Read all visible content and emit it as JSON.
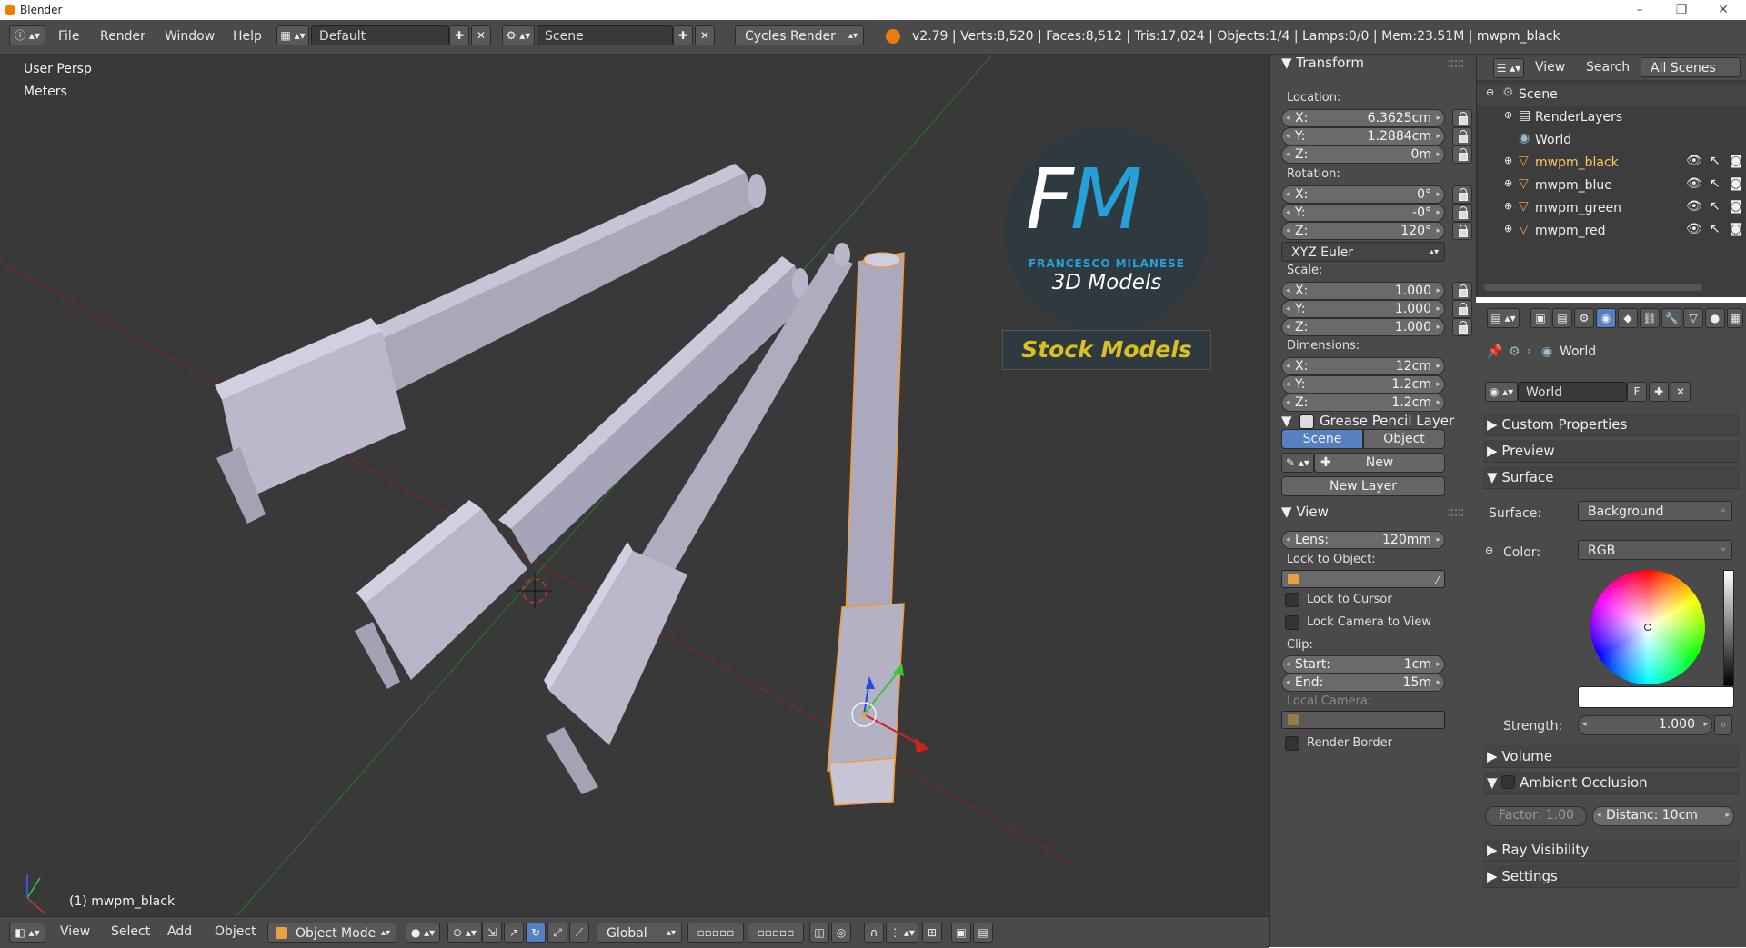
{
  "window": {
    "title": "Blender"
  },
  "topbar": {
    "menus": [
      "File",
      "Render",
      "Window",
      "Help"
    ],
    "screen_layout": "Default",
    "scene": "Scene",
    "engine": "Cycles Render",
    "stats": "v2.79 | Verts:8,520 | Faces:8,512 | Tris:17,024 | Objects:1/4 | Lamps:0/0 | Mem:23.51M | mwpm_black"
  },
  "viewport": {
    "view_name": "User Persp",
    "units": "Meters",
    "active_object": "(1) mwpm_black",
    "logo": {
      "initials": "FM",
      "name": "FRANCESCO MILANESE",
      "subtitle": "3D Models",
      "banner": "Stock Models"
    }
  },
  "bottombar": {
    "menus": [
      "View",
      "Select",
      "Add",
      "Object"
    ],
    "mode": "Object Mode",
    "orientation": "Global"
  },
  "npanel": {
    "transform": {
      "header": "Transform",
      "location_label": "Location:",
      "location": [
        [
          "X:",
          "6.3625cm"
        ],
        [
          "Y:",
          "1.2884cm"
        ],
        [
          "Z:",
          "0m"
        ]
      ],
      "rotation_label": "Rotation:",
      "rotation": [
        [
          "X:",
          "0°"
        ],
        [
          "Y:",
          "-0°"
        ],
        [
          "Z:",
          "120°"
        ]
      ],
      "rotation_mode": "XYZ Euler",
      "scale_label": "Scale:",
      "scale": [
        [
          "X:",
          "1.000"
        ],
        [
          "Y:",
          "1.000"
        ],
        [
          "Z:",
          "1.000"
        ]
      ],
      "dimensions_label": "Dimensions:",
      "dimensions": [
        [
          "X:",
          "12cm"
        ],
        [
          "Y:",
          "1.2cm"
        ],
        [
          "Z:",
          "1.2cm"
        ]
      ]
    },
    "grease": {
      "header": "Grease Pencil Layer",
      "tab_scene": "Scene",
      "tab_object": "Object",
      "new": "New",
      "new_layer": "New Layer"
    },
    "view": {
      "header": "View",
      "lens_key": "Lens:",
      "lens_val": "120mm",
      "lock_object_label": "Lock to Object:",
      "lock_cursor": "Lock to Cursor",
      "lock_camera": "Lock Camera to View",
      "clip_label": "Clip:",
      "clip_start": [
        "Start:",
        "1cm"
      ],
      "clip_end": [
        "End:",
        "15m"
      ],
      "local_camera": "Local Camera:",
      "render_border": "Render Border"
    }
  },
  "outliner": {
    "menus": [
      "View",
      "Search"
    ],
    "filter": "All Scenes",
    "items": [
      "Scene",
      "RenderLayers",
      "World",
      "mwpm_black",
      "mwpm_blue",
      "mwpm_green",
      "mwpm_red"
    ]
  },
  "properties": {
    "breadcrumb": "World",
    "world_name": "World",
    "fake_user": "F",
    "sections": {
      "custom": "Custom Properties",
      "preview": "Preview",
      "surface": "Surface",
      "volume": "Volume",
      "ao": "Ambient Occlusion",
      "ray": "Ray Visibility",
      "settings": "Settings"
    },
    "surface_label": "Surface:",
    "surface_value": "Background",
    "color_label": "Color:",
    "color_mode": "RGB",
    "strength_label": "Strength:",
    "strength_value": "1.000",
    "ao_factor": "Factor:   1.00",
    "ao_distance": "Distanc: 10cm"
  }
}
